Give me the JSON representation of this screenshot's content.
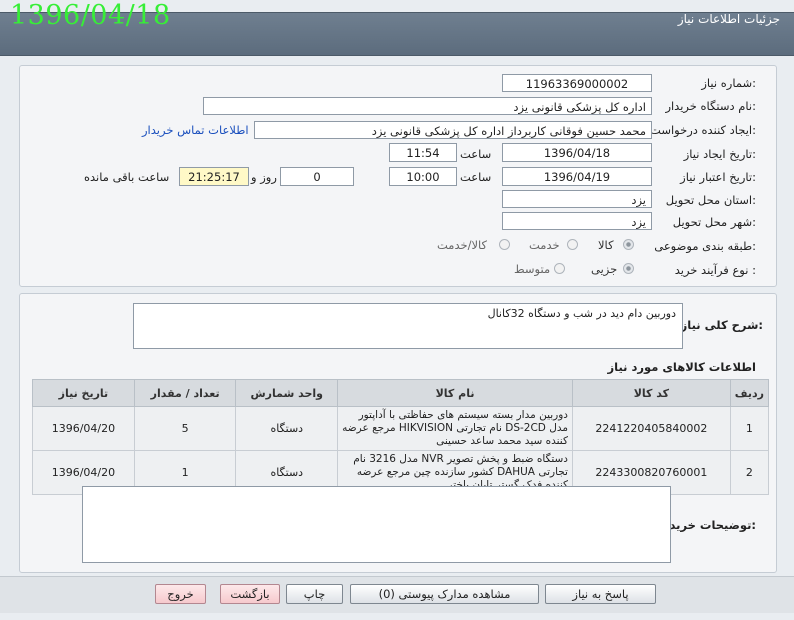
{
  "header": {
    "title": "جزئیات اطلاعات نیاز",
    "date": "1396/04/18"
  },
  "form": {
    "need_number": {
      "label": "شماره نیاز:",
      "value": "1196336900000​2"
    },
    "buyer_org": {
      "label": "نام دستگاه خریدار:",
      "value": "اداره کل پزشکی قانونی یزد"
    },
    "requester": {
      "label": "ایجاد کننده درخواست:",
      "value": "محمد حسین فوقانی کاربرداز اداره کل پزشکی قانونی یزد",
      "contact_link": "اطلاعات تماس خریدار"
    },
    "created": {
      "label": "تاریخ ایجاد نیاز:",
      "date": "1396/04/18",
      "time_label": "ساعت",
      "time": "11:54"
    },
    "valid": {
      "label": "تاریخ اعتبار نیاز:",
      "date": "1396/04/19",
      "time_label": "ساعت",
      "time": "10:00",
      "days": "0",
      "days_label": "روز و",
      "remaining": "21:25:17",
      "remaining_label": "ساعت باقی مانده"
    },
    "province": {
      "label": "استان محل تحویل:",
      "value": "یزد"
    },
    "city": {
      "label": "شهر محل تحویل:",
      "value": "یزد"
    },
    "category": {
      "label": "طبقه بندی موضوعی:",
      "options": [
        "کالا",
        "خدمت",
        "کالا/خدمت"
      ],
      "selected": "کالا"
    },
    "process": {
      "label": "نوع فرآیند خرید :",
      "options": [
        "جزیی",
        "متوسط"
      ],
      "selected": "جزیی"
    }
  },
  "description": {
    "label": "شرح کلی نیاز:",
    "value": "دوربین دام دید در شب و دستگاه 32کانال"
  },
  "items": {
    "title": "اطلاعات کالاهای مورد نیاز",
    "columns": [
      "ردیف",
      "کد کالا",
      "نام کالا",
      "واحد شمارش",
      "تعداد / مقدار",
      "تاریخ نیاز"
    ],
    "rows": [
      {
        "row": "1",
        "code": "2241220405840002",
        "name": "دوربین مدار بسته سیستم های حفاظتی با آداپتور مدل DS-2CD نام تجارتی HIKVISION مرجع عرضه کننده سید محمد ساعد حسینی",
        "unit": "دستگاه",
        "qty": "5",
        "date": "1396/04/20"
      },
      {
        "row": "2",
        "code": "2243300820760001",
        "name": "دستگاه ضبط و پخش تصویر NVR مدل 3216 نام تجارتی DAHUA کشور سازنده چین مرجع عرضه کننده فدک گستر تابان باختر",
        "unit": "دستگاه",
        "qty": "1",
        "date": "1396/04/20"
      }
    ]
  },
  "buyer_notes": {
    "label": "توضیحات خریدار:",
    "value": ""
  },
  "buttons": {
    "reply": "پاسخ به نیاز",
    "attachments": "مشاهده مدارک پیوستی (0)",
    "print": "چاپ",
    "back": "بازگشت",
    "exit": "خروج"
  },
  "colors": {
    "header_bg": "#5c6c7d",
    "date_green": "#37ee37",
    "link_blue": "#1a4fbd",
    "remaining_bg": "#fff9c7"
  }
}
